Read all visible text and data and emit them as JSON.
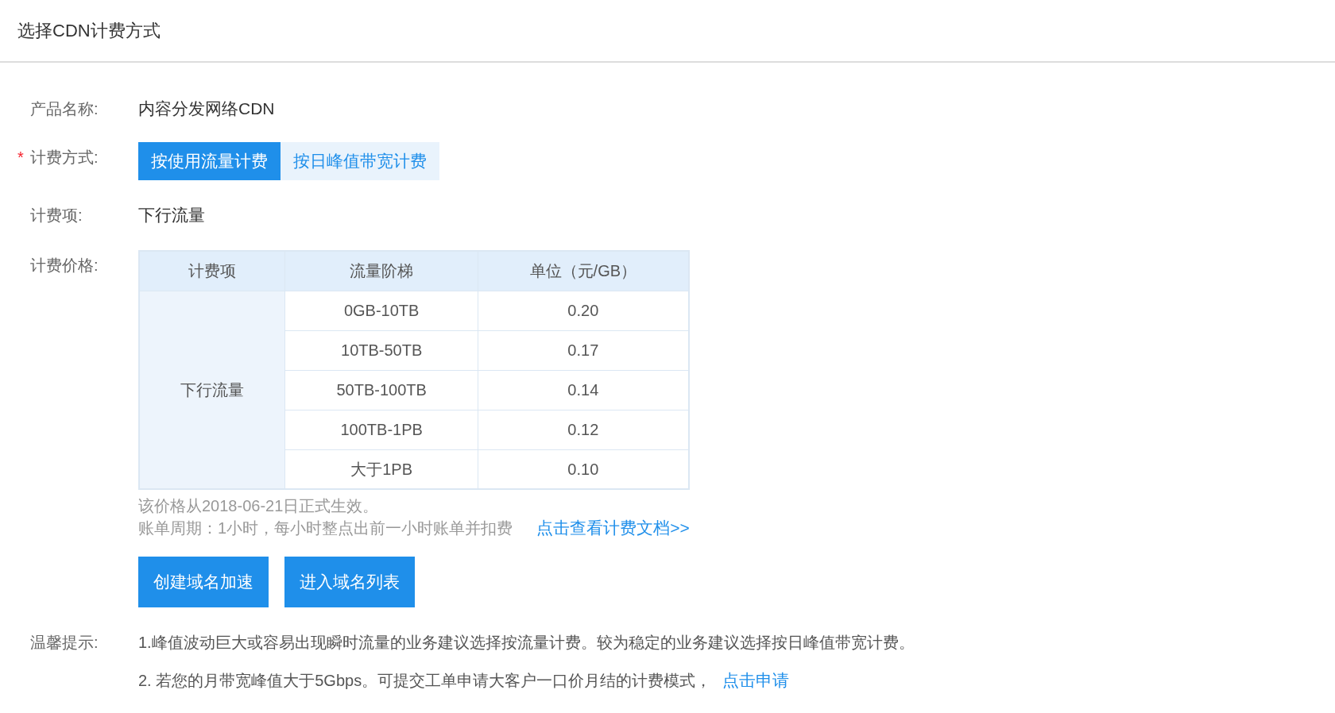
{
  "header": {
    "title": "选择CDN计费方式"
  },
  "product": {
    "label": "产品名称:",
    "value": "内容分发网络CDN"
  },
  "billing_method": {
    "label": "计费方式:",
    "required_mark": "*",
    "options": [
      {
        "label": "按使用流量计费",
        "selected": true
      },
      {
        "label": "按日峰值带宽计费",
        "selected": false
      }
    ]
  },
  "billing_item": {
    "label": "计费项:",
    "value": "下行流量"
  },
  "pricing": {
    "label": "计费价格:",
    "table": {
      "columns": [
        "计费项",
        "流量阶梯",
        "单位（元/GB）"
      ],
      "item": "下行流量",
      "rows": [
        {
          "tier": "0GB-10TB",
          "price": "0.20"
        },
        {
          "tier": "10TB-50TB",
          "price": "0.17"
        },
        {
          "tier": "50TB-100TB",
          "price": "0.14"
        },
        {
          "tier": "100TB-1PB",
          "price": "0.12"
        },
        {
          "tier": "大于1PB",
          "price": "0.10"
        }
      ]
    },
    "effective_note": "该价格从2018-06-21日正式生效。",
    "cycle_note": "账单周期：1小时，每小时整点出前一小时账单并扣费",
    "doc_link": "点击查看计费文档>>"
  },
  "buttons": [
    "创建域名加速",
    "进入域名列表"
  ],
  "tips": {
    "label": "温馨提示:",
    "items": [
      {
        "text": "1.峰值波动巨大或容易出现瞬时流量的业务建议选择按流量计费。较为稳定的业务建议选择按日峰值带宽计费。"
      },
      {
        "text": "2. 若您的月带宽峰值大于5Gbps。可提交工单申请大客户一口价月结的计费模式，",
        "link": "点击申请"
      }
    ]
  }
}
